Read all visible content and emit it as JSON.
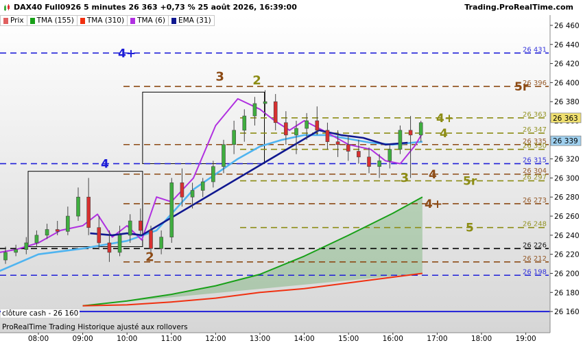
{
  "header": {
    "title": "DAX40 Full0926 5 minutes 26 363 +0,73 % 25 août 2026, 16:39:00",
    "brand": "Trading.ProRealTime.com"
  },
  "legend": [
    {
      "label": "Prix",
      "color": "#e06060",
      "icon": "candlestick-icon"
    },
    {
      "label": "TMA (155)",
      "color": "#18a018"
    },
    {
      "label": "TMA (310)",
      "color": "#f03010"
    },
    {
      "label": "TMA (6)",
      "color": "#b030e0"
    },
    {
      "label": "EMA (31)",
      "color": "#101890"
    }
  ],
  "footer_note": "ProRealTime Trading  Historique ajusté aux rollovers",
  "cash_label": "clôture cash -  26 160",
  "price_tags": {
    "last": "26 363",
    "ema": "26 339"
  },
  "colors": {
    "blue": "#1e1ed8",
    "brown": "#8c4a14",
    "olive": "#8c8c14",
    "up": "#3fae3f",
    "down": "#d83030"
  },
  "chart_data": {
    "type": "candlestick",
    "y_axis": {
      "min": 26150,
      "max": 26465,
      "ticks": [
        26160,
        26180,
        26200,
        26220,
        26240,
        26260,
        26280,
        26300,
        26320,
        26340,
        26360,
        26380,
        26400,
        26420,
        26440,
        26460
      ]
    },
    "x_axis": {
      "ticks": [
        "08:00",
        "09:00",
        "10:00",
        "11:00",
        "12:00",
        "13:00",
        "14:00",
        "15:00",
        "16:00",
        "17:00",
        "18:00",
        "19:00"
      ]
    },
    "levels": [
      {
        "value": 26431,
        "label": "26 431",
        "kind": "blue",
        "tag": "4+",
        "tag_x": "left"
      },
      {
        "value": 26396,
        "label": "26 396",
        "kind": "brown",
        "tag": "5r"
      },
      {
        "value": 26363,
        "label": "26 363",
        "kind": "olive",
        "tag": "4+"
      },
      {
        "value": 26347,
        "label": "26 347",
        "kind": "olive",
        "tag": "4"
      },
      {
        "value": 26335,
        "label": "26 335",
        "kind": "brown"
      },
      {
        "value": 26330,
        "label": "26 330",
        "kind": "olive"
      },
      {
        "value": 26315,
        "label": "26 315",
        "kind": "blue",
        "tag": "4",
        "tag_x": "left"
      },
      {
        "value": 26304,
        "label": "26 304",
        "kind": "brown",
        "tag": "4"
      },
      {
        "value": 26297,
        "label": "26 297",
        "kind": "olive",
        "tag": "5r"
      },
      {
        "value": 26273,
        "label": "26 273",
        "kind": "brown",
        "tag": "4+"
      },
      {
        "value": 26248,
        "label": "26 248",
        "kind": "olive",
        "tag": "5"
      },
      {
        "value": 26226,
        "label": "26 226",
        "kind": "black"
      },
      {
        "value": 26212,
        "label": "26 212",
        "kind": "brown"
      },
      {
        "value": 26198,
        "label": "26 198",
        "kind": "blue"
      },
      {
        "value": 26160,
        "label": "",
        "kind": "solidblue"
      }
    ],
    "annotations": [
      {
        "text": "3",
        "kind": "brown",
        "time": "12:00",
        "value": 26402
      },
      {
        "text": "2",
        "kind": "olive",
        "time": "12:50",
        "value": 26398
      },
      {
        "text": "2",
        "kind": "brown",
        "time": "10:25",
        "value": 26213
      },
      {
        "text": "3",
        "kind": "olive",
        "time": "16:10",
        "value": 26296
      }
    ],
    "boxes": [
      {
        "t1": "08:00",
        "t2": "10:35",
        "hi": 26307,
        "lo": 26228
      },
      {
        "t1": "10:35",
        "t2": "13:20",
        "hi": 26390,
        "lo": 26315
      }
    ],
    "series": [
      {
        "name": "TMA (155)",
        "color": "#18a018",
        "points": [
          [
            "09:00",
            26166
          ],
          [
            "10:00",
            26171
          ],
          [
            "11:00",
            26178
          ],
          [
            "12:00",
            26187
          ],
          [
            "13:00",
            26199
          ],
          [
            "14:00",
            26218
          ],
          [
            "15:00",
            26240
          ],
          [
            "16:00",
            26263
          ],
          [
            "16:40",
            26280
          ]
        ]
      },
      {
        "name": "TMA (310)",
        "color": "#f03010",
        "points": [
          [
            "09:00",
            26166
          ],
          [
            "10:00",
            26167
          ],
          [
            "11:00",
            26170
          ],
          [
            "12:00",
            26174
          ],
          [
            "13:00",
            26180
          ],
          [
            "14:00",
            26184
          ],
          [
            "15:00",
            26190
          ],
          [
            "16:00",
            26196
          ],
          [
            "16:40",
            26200
          ]
        ]
      },
      {
        "name": "EMA (31)",
        "color": "#4fb4f0",
        "points": [
          [
            "07:00",
            26200
          ],
          [
            "08:00",
            26220
          ],
          [
            "09:00",
            26226
          ],
          [
            "10:00",
            26234
          ],
          [
            "10:40",
            26245
          ],
          [
            "11:30",
            26288
          ],
          [
            "12:30",
            26320
          ],
          [
            "13:00",
            26333
          ],
          [
            "13:30",
            26340
          ],
          [
            "14:00",
            26345
          ],
          [
            "14:30",
            26345
          ],
          [
            "15:00",
            26341
          ],
          [
            "15:30",
            26337
          ],
          [
            "16:00",
            26335
          ],
          [
            "16:40",
            26338
          ]
        ]
      },
      {
        "name": "TMA (6)",
        "color": "#b030e0",
        "points": [
          [
            "07:00",
            26221
          ],
          [
            "07:30",
            26225
          ],
          [
            "08:00",
            26232
          ],
          [
            "08:30",
            26245
          ],
          [
            "09:00",
            26250
          ],
          [
            "09:20",
            26262
          ],
          [
            "09:40",
            26238
          ],
          [
            "10:00",
            26250
          ],
          [
            "10:20",
            26235
          ],
          [
            "10:40",
            26280
          ],
          [
            "11:00",
            26275
          ],
          [
            "11:30",
            26300
          ],
          [
            "12:00",
            26355
          ],
          [
            "12:30",
            26383
          ],
          [
            "13:00",
            26372
          ],
          [
            "13:20",
            26360
          ],
          [
            "13:40",
            26350
          ],
          [
            "14:00",
            26360
          ],
          [
            "14:30",
            26348
          ],
          [
            "15:00",
            26335
          ],
          [
            "15:30",
            26330
          ],
          [
            "15:50",
            26318
          ],
          [
            "16:10",
            26315
          ],
          [
            "16:30",
            26334
          ],
          [
            "16:40",
            26347
          ]
        ]
      },
      {
        "name": "EMA (31) dark",
        "color": "#101890",
        "points": [
          [
            "09:10",
            26242
          ],
          [
            "09:40",
            26240
          ],
          [
            "10:00",
            26242
          ],
          [
            "10:20",
            26240
          ],
          [
            "14:20",
            26350
          ],
          [
            "14:50",
            26345
          ],
          [
            "15:20",
            26342
          ],
          [
            "15:50",
            26335
          ],
          [
            "16:20",
            26337
          ]
        ]
      }
    ],
    "candles_ohlc": [
      [
        26214,
        26228,
        26210,
        26222
      ],
      [
        26222,
        26230,
        26218,
        26225
      ],
      [
        26225,
        26238,
        26220,
        26232
      ],
      [
        26232,
        26245,
        26228,
        26240
      ],
      [
        26240,
        26252,
        26236,
        26246
      ],
      [
        26246,
        26255,
        26240,
        26244
      ],
      [
        26244,
        26270,
        26240,
        26260
      ],
      [
        26260,
        26290,
        26255,
        26280
      ],
      [
        26280,
        26300,
        26240,
        26248
      ],
      [
        26248,
        26260,
        26225,
        26232
      ],
      [
        26232,
        26245,
        26212,
        26222
      ],
      [
        26222,
        26250,
        26218,
        26240
      ],
      [
        26240,
        26262,
        26232,
        26255
      ],
      [
        26255,
        26268,
        26240,
        26245
      ],
      [
        26245,
        26250,
        26218,
        26226
      ],
      [
        26226,
        26245,
        26220,
        26238
      ],
      [
        26238,
        26300,
        26232,
        26295
      ],
      [
        26295,
        26310,
        26270,
        26280
      ],
      [
        26280,
        26295,
        26268,
        26287
      ],
      [
        26287,
        26300,
        26280,
        26296
      ],
      [
        26296,
        26318,
        26290,
        26312
      ],
      [
        26312,
        26340,
        26305,
        26335
      ],
      [
        26335,
        26360,
        26325,
        26350
      ],
      [
        26350,
        26372,
        26338,
        26365
      ],
      [
        26365,
        26385,
        26355,
        26378
      ],
      [
        26378,
        26392,
        26365,
        26380
      ],
      [
        26380,
        26388,
        26350,
        26358
      ],
      [
        26358,
        26370,
        26335,
        26345
      ],
      [
        26345,
        26360,
        26325,
        26352
      ],
      [
        26352,
        26368,
        26340,
        26360
      ],
      [
        26360,
        26375,
        26345,
        26350
      ],
      [
        26350,
        26358,
        26330,
        26338
      ],
      [
        26338,
        26350,
        26322,
        26335
      ],
      [
        26335,
        26345,
        26318,
        26328
      ],
      [
        26328,
        26340,
        26315,
        26322
      ],
      [
        26322,
        26332,
        26305,
        26312
      ],
      [
        26312,
        26325,
        26300,
        26318
      ],
      [
        26318,
        26335,
        26310,
        26330
      ],
      [
        26330,
        26355,
        26325,
        26350
      ],
      [
        26350,
        26365,
        26300,
        26345
      ],
      [
        26345,
        26360,
        26338,
        26358
      ]
    ]
  }
}
